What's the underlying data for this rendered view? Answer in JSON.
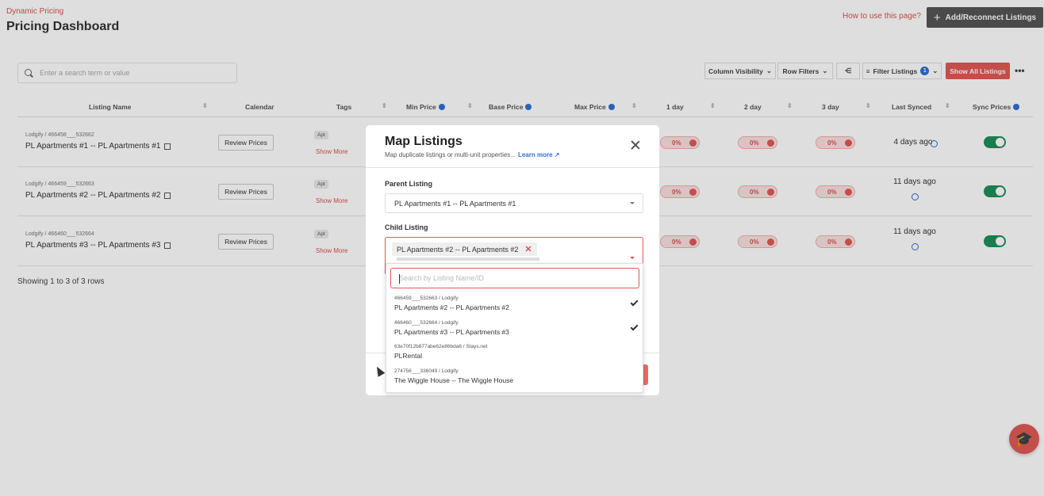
{
  "header": {
    "breadcrumb": "Dynamic Pricing",
    "title": "Pricing Dashboard",
    "howto_link": "How to use this page?",
    "add_button": "Add/Reconnect Listings"
  },
  "toolbar": {
    "search_placeholder": "Enter a search term or value",
    "column_visibility": "Column Visibility",
    "row_filters": "Row Filters",
    "filter_listings": "Filter Listings",
    "filter_count": "1",
    "show_all": "Show All Listings",
    "more": "•••"
  },
  "table": {
    "columns": [
      "Listing Name",
      "Calendar",
      "Tags",
      "Min Price",
      "Base Price",
      "Max Price",
      "1 day",
      "2 day",
      "3 day",
      "Last Synced",
      "Sync Prices"
    ],
    "rows": [
      {
        "sub": "Lodgify / 466458___532662",
        "name": "PL Apartments #1 -- PL Apartments #1",
        "review": "Review Prices",
        "tag": "Apt",
        "showmore": "Show More",
        "p1": "0%",
        "p2": "0%",
        "p3": "0%",
        "synced": "4 days ago"
      },
      {
        "sub": "Lodgify / 466459___532663",
        "name": "PL Apartments #2 -- PL Apartments #2",
        "review": "Review Prices",
        "tag": "Apt",
        "showmore": "Show More",
        "p1": "0%",
        "p2": "0%",
        "p3": "0%",
        "synced": "11 days ago"
      },
      {
        "sub": "Lodgify / 466460___532664",
        "name": "PL Apartments #3 -- PL Apartments #3",
        "review": "Review Prices",
        "tag": "Apt",
        "showmore": "Show More",
        "p1": "0%",
        "p2": "0%",
        "p3": "0%",
        "synced": "11 days ago"
      }
    ],
    "footer": "Showing 1 to 3 of 3 rows"
  },
  "modal": {
    "title": "Map Listings",
    "subtitle": "Map duplicate listings or multi-unit properties...",
    "learn_more": "Learn more",
    "parent_label": "Parent Listing",
    "parent_value": "PL Apartments #1 -- PL Apartments #1",
    "child_label": "Child Listing",
    "child_chip": "PL Apartments #2 -- PL Apartments #2",
    "search_placeholder": "Search by Listing Name/ID",
    "options": [
      {
        "id": "466459___532663 / Lodgify",
        "name": "PL Apartments #2 -- PL Apartments #2",
        "checked": true
      },
      {
        "id": "466460___532664 / Lodgify",
        "name": "PL Apartments #3 -- PL Apartments #3",
        "checked": true
      },
      {
        "id": "63e70f12b877abe62e86bda6 / Stays.net",
        "name": "PLRental",
        "checked": false
      },
      {
        "id": "274756___336049 / Lodgify",
        "name": "The Wiggle House -- The Wiggle House",
        "checked": false
      }
    ]
  },
  "colors": {
    "accent": "#e05a55",
    "link": "#2f6fd6",
    "toggle_on": "#1f8f5a"
  }
}
